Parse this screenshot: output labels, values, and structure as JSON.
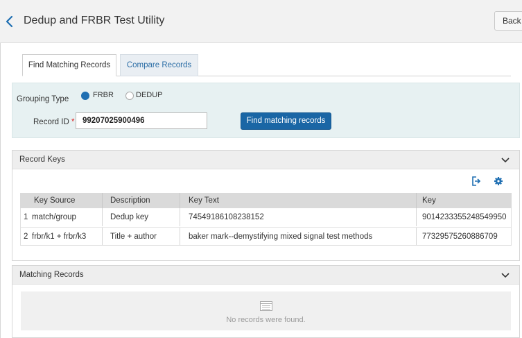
{
  "header": {
    "title": "Dedup and FRBR Test Utility",
    "back_label": "Back"
  },
  "tabs": [
    {
      "label": "Find Matching Records",
      "active": true
    },
    {
      "label": "Compare Records",
      "active": false
    }
  ],
  "form": {
    "grouping_type_label": "Grouping Type",
    "options": [
      {
        "label": "FRBR",
        "selected": true
      },
      {
        "label": "DEDUP",
        "selected": false
      }
    ],
    "record_id_label": "Record ID",
    "required_mark": "*",
    "record_id_value": "99207025900496",
    "find_button_label": "Find matching records"
  },
  "record_keys": {
    "title": "Record Keys",
    "icons": [
      "export-icon",
      "gear-icon",
      "chevron-down-icon"
    ],
    "columns": [
      "Key Source",
      "Description",
      "Key Text",
      "Key"
    ],
    "rows": [
      {
        "num": "1",
        "key_source": "match/group",
        "description": "Dedup key",
        "key_text": "74549186108238152",
        "key": "9014233355248549950"
      },
      {
        "num": "2",
        "key_source": "frbr/k1 + frbr/k3",
        "description": "Title + author",
        "key_text": "baker mark--demystifying mixed signal test methods",
        "key": "77329575260886709"
      }
    ]
  },
  "matching_records": {
    "title": "Matching Records",
    "empty_text": "No records were found."
  },
  "colors": {
    "accent": "#1a66a5",
    "tab_inactive_text": "#2c6ea6",
    "form_background": "#e7f1f2",
    "required": "#dd2222"
  }
}
